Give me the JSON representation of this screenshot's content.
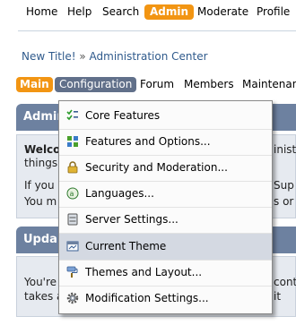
{
  "top_menu": {
    "items": [
      {
        "label": "Home",
        "active": false
      },
      {
        "label": "Help",
        "active": false
      },
      {
        "label": "Search",
        "active": false
      },
      {
        "label": "Admin",
        "active": true
      },
      {
        "label": "Moderate",
        "active": false
      },
      {
        "label": "Profile",
        "active": false
      }
    ]
  },
  "breadcrumb": {
    "items": [
      "New Title!",
      "Administration Center"
    ],
    "separator": "»"
  },
  "sub_menu": {
    "items": [
      {
        "label": "Main",
        "style": "orange"
      },
      {
        "label": "Configuration",
        "style": "selected"
      },
      {
        "label": "Forum",
        "style": "plain"
      },
      {
        "label": "Members",
        "style": "plain"
      },
      {
        "label": "Maintenanc",
        "style": "plain"
      }
    ]
  },
  "background": {
    "panel1_title": "Admir",
    "panel1_lines": [
      "Welco",
      "things",
      "If you",
      "You m"
    ],
    "panel1_right": [
      "inist",
      "Sup",
      "s or"
    ],
    "panel2_title": "Upda",
    "panel2_lines": [
      "You're",
      "takes a"
    ],
    "panel2_right": [
      "conta",
      "it"
    ]
  },
  "dropdown": {
    "items": [
      {
        "label": "Core Features",
        "icon": "core-features-icon",
        "highlighted": false
      },
      {
        "label": "Features and Options...",
        "icon": "features-grid-icon",
        "highlighted": false
      },
      {
        "label": "Security and Moderation...",
        "icon": "lock-icon",
        "highlighted": false
      },
      {
        "label": "Languages...",
        "icon": "languages-icon",
        "highlighted": false
      },
      {
        "label": "Server Settings...",
        "icon": "server-icon",
        "highlighted": false
      },
      {
        "label": "Current Theme",
        "icon": "theme-icon",
        "highlighted": true
      },
      {
        "label": "Themes and Layout...",
        "icon": "paint-icon",
        "highlighted": false
      },
      {
        "label": "Modification Settings...",
        "icon": "gear-icon",
        "highlighted": false
      }
    ]
  },
  "colors": {
    "accent_orange": "#f29513",
    "selected_tab": "#61708a",
    "panel_header": "#6d81a0",
    "link_blue": "#2f5a8c",
    "highlight_row": "#d4d9e2"
  }
}
